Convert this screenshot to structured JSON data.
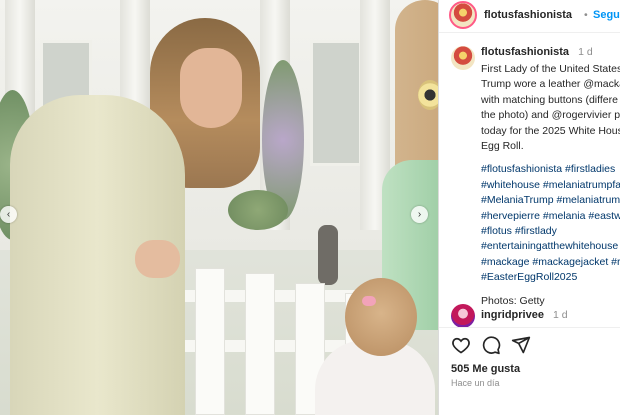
{
  "header": {
    "username": "flotusfashionista",
    "separator": "•",
    "follow_label": "Seguir"
  },
  "post": {
    "username": "flotusfashionista",
    "time": "1 d",
    "caption_lines": [
      "First Lady of the United States",
      "Trump wore a leather @macka",
      "with matching buttons (differe",
      "the photo) and @rogervivier p",
      "today for the 2025 White Hous",
      "Egg Roll.",
      "",
      "#flotusfashionista #firstladies",
      "#whitehouse #melaniatrumpfa",
      "#MelaniaTrump #melaniatrum",
      "#hervepierre #melania #eastw",
      "#flotus #firstlady",
      "#entertainingatthewhitehouse",
      "#mackage #mackagejacket #r",
      "#EasterEggRoll2025",
      "",
      "Photos: Getty"
    ]
  },
  "comment": {
    "username": "ingridprivee",
    "time": "1 d"
  },
  "footer": {
    "likes": "505 Me gusta",
    "when": "Hace un día"
  },
  "icons": [
    "heart-icon",
    "comment-icon",
    "share-icon",
    "prev-arrow-icon",
    "next-arrow-icon"
  ],
  "colors": {
    "accent": "#0095f6",
    "link": "#00376b",
    "muted": "#8e8e8e"
  }
}
